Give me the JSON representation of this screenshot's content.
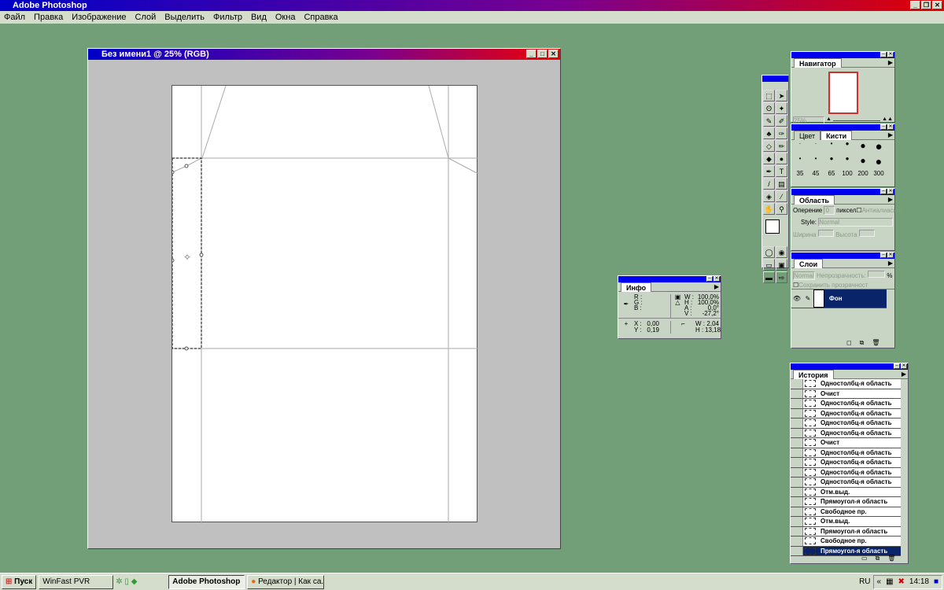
{
  "app": {
    "title": "Adobe Photoshop"
  },
  "menu": [
    "Файл",
    "Правка",
    "Изображение",
    "Слой",
    "Выделить",
    "Фильтр",
    "Вид",
    "Окна",
    "Справка"
  ],
  "document": {
    "title": "Без имени1 @ 25% (RGB)"
  },
  "navigator": {
    "tab": "Навигатор",
    "zoom": "25%"
  },
  "brushes": {
    "tabs": [
      "Цвет",
      "Кисти"
    ],
    "sizes": [
      "35",
      "45",
      "65",
      "100",
      "200",
      "300"
    ]
  },
  "area": {
    "tab": "Область",
    "feather_label": "Оперение",
    "feather_value": "0",
    "unit": "пиксел",
    "antialias": "Антиалиасинг",
    "style_label": "Style:",
    "style_value": "Normal",
    "width_label": "Ширина",
    "height_label": "Высота"
  },
  "layers": {
    "tab": "Слои",
    "mode": "Normal",
    "opacity_label": "Непрозрачность:",
    "percent": "%",
    "preserve": "Сохранить прозрачност",
    "layer_name": "Фон"
  },
  "info": {
    "tab": "Инфо",
    "r": "R :",
    "g": "G :",
    "b": "B :",
    "w1": "W :",
    "w1v": "100,0%",
    "h1": "H :",
    "h1v": "100,0%",
    "a": "A :",
    "av": "0,0°",
    "v": "V :",
    "vv": "-27,2°",
    "x": "X :",
    "xv": "0,00",
    "y": "Y :",
    "yv": "0,19",
    "w2": "W :",
    "w2v": "2,04",
    "h2": "H :",
    "h2v": "13,18"
  },
  "history": {
    "tab": "История",
    "items": [
      "Одностолбц-я область",
      "Очист",
      "Одностолбц-я область",
      "Одностолбц-я область",
      "Одностолбц-я область",
      "Одностолбц-я область",
      "Очист",
      "Одностолбц-я область",
      "Одностолбц-я область",
      "Одностолбц-я область",
      "Одностолбц-я область",
      "Отм.выд.",
      "Прямоугол-я область",
      "Свободное пр.",
      "Отм.выд.",
      "Прямоугол-я область",
      "Свободное пр.",
      "Прямоугол-я область"
    ],
    "selected": 17
  },
  "taskbar": {
    "start": "Пуск",
    "items": [
      "WinFast PVR",
      "Adobe Photoshop",
      "Редактор | Как са..."
    ],
    "active": "Adobe Photoshop",
    "lang": "RU",
    "clock": "14:18"
  }
}
